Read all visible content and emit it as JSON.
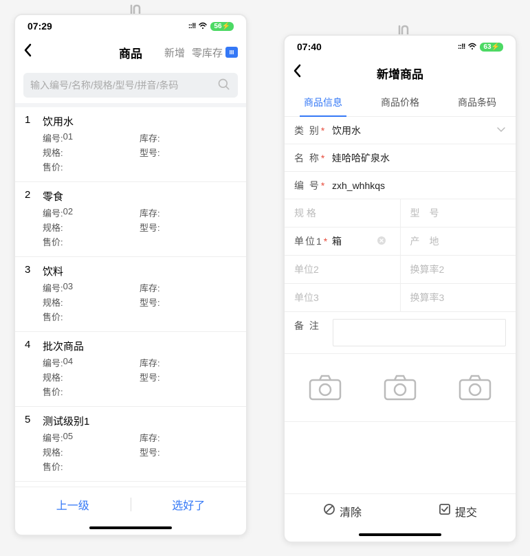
{
  "left": {
    "time": "07:29",
    "battery": "56",
    "title": "商品",
    "actions": {
      "add": "新增",
      "zero_stock": "零库存"
    },
    "search_placeholder": "输入编号/名称/规格/型号/拼音/条码",
    "field_labels": {
      "code": "编号:",
      "stock": "库存:",
      "spec": "规格:",
      "model": "型号:",
      "price": "售价:"
    },
    "items": [
      {
        "idx": "1",
        "name": "饮用水",
        "code": "01",
        "stock": "",
        "spec": "",
        "model": "",
        "price": ""
      },
      {
        "idx": "2",
        "name": "零食",
        "code": "02",
        "stock": "",
        "spec": "",
        "model": "",
        "price": ""
      },
      {
        "idx": "3",
        "name": "饮料",
        "code": "03",
        "stock": "",
        "spec": "",
        "model": "",
        "price": ""
      },
      {
        "idx": "4",
        "name": "批次商品",
        "code": "04",
        "stock": "",
        "spec": "",
        "model": "",
        "price": ""
      },
      {
        "idx": "5",
        "name": "测试级别1",
        "code": "05",
        "stock": "",
        "spec": "",
        "model": "",
        "price": ""
      }
    ],
    "bottom": {
      "prev": "上一级",
      "done": "选好了"
    }
  },
  "right": {
    "time": "07:40",
    "battery": "63",
    "title": "新增商品",
    "tabs": [
      {
        "label": "商品信息",
        "active": true
      },
      {
        "label": "商品价格",
        "active": false
      },
      {
        "label": "商品条码",
        "active": false
      }
    ],
    "form": {
      "category_label": "类 别",
      "category_value": "饮用水",
      "name_label": "名 称",
      "name_value": "娃哈哈矿泉水",
      "code_label": "编 号",
      "code_value": "zxh_whhkqs",
      "spec_label": "规 格",
      "model_label": "型　号",
      "unit1_label": "单位1",
      "unit1_value": "箱",
      "origin_label": "产　地",
      "unit2_label": "单位2",
      "rate2_label": "换算率2",
      "unit3_label": "单位3",
      "rate3_label": "换算率3",
      "remark_label": "备 注"
    },
    "bottom": {
      "clear": "清除",
      "submit": "提交"
    }
  }
}
